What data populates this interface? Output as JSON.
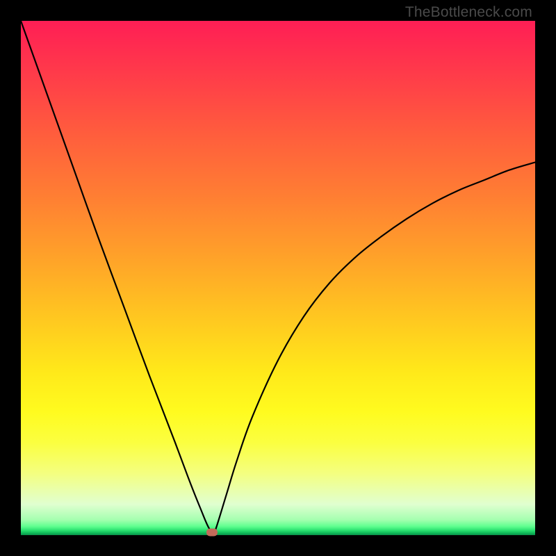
{
  "watermark": "TheBottleneck.com",
  "chart_data": {
    "type": "line",
    "title": "",
    "xlabel": "",
    "ylabel": "",
    "xlim": [
      0,
      100
    ],
    "ylim": [
      0,
      100
    ],
    "grid": false,
    "series": [
      {
        "name": "bottleneck-curve",
        "x": [
          0,
          5,
          10,
          15,
          20,
          25,
          30,
          33,
          35,
          36.5,
          37.5,
          38,
          40,
          42,
          45,
          50,
          55,
          60,
          65,
          70,
          75,
          80,
          85,
          90,
          95,
          100
        ],
        "values": [
          100,
          86,
          72,
          58,
          44.5,
          31,
          18,
          10,
          5,
          1.5,
          0.5,
          1.5,
          8,
          14.5,
          23,
          34,
          42.5,
          49,
          54,
          58,
          61.5,
          64.5,
          67,
          69,
          71,
          72.5
        ]
      }
    ],
    "marker": {
      "x": 37.2,
      "y": 0.5,
      "color": "#c36b5a"
    },
    "background_gradient": {
      "top": "#ff1e55",
      "upper_mid": "#ff7e33",
      "mid": "#ffe81a",
      "lower_mid": "#f4ff80",
      "bottom": "#0a8f4a"
    }
  }
}
